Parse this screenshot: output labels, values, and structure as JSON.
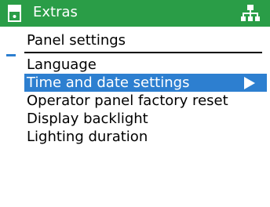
{
  "title_bar": {
    "title": "Extras",
    "device_icon": "panel-device-icon",
    "network_icon": "network-hierarchy-icon",
    "color": "#2a9d47"
  },
  "section": {
    "header": "Panel settings"
  },
  "menu": {
    "selection_color": "#2d7fd0",
    "items": [
      {
        "label": "Language",
        "selected": false
      },
      {
        "label": "Time and date settings",
        "selected": true,
        "icon": "play-arrow-icon"
      },
      {
        "label": "Operator panel factory reset",
        "selected": false
      },
      {
        "label": "Display backlight",
        "selected": false
      },
      {
        "label": "Lighting duration",
        "selected": false
      }
    ]
  }
}
